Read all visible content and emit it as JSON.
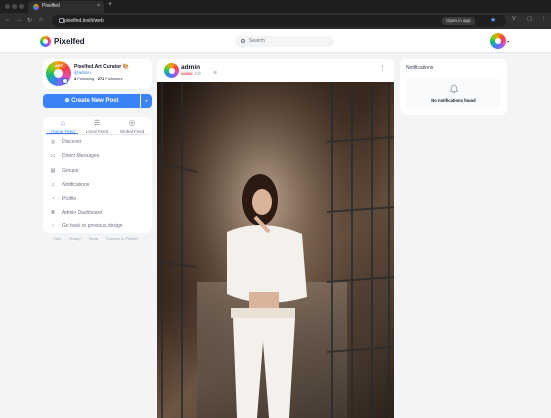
{
  "browser": {
    "tab_title": "Pixelfed",
    "tab_close": "×",
    "new_tab": "+",
    "url": "pixelfed.test/i/web",
    "open_in_app": "Open in app"
  },
  "header": {
    "brand": "Pixelfed",
    "search_placeholder": "Search",
    "avatar_caret": "▾"
  },
  "profile": {
    "name": "Pixelfed.Art Curator 🎨",
    "handle": "@admin",
    "following_count": "4",
    "following_label": "Following",
    "followers_count": "271",
    "followers_label": "Followers",
    "avatar_badge": "ART"
  },
  "compose": {
    "label": "Create New Post",
    "icon": "⊕",
    "caret": "▾"
  },
  "feed_tabs": [
    {
      "label": "Home Feed",
      "icon": "⌂",
      "active": true
    },
    {
      "label": "Local Feed",
      "icon": "☰",
      "active": false
    },
    {
      "label": "Global Feed",
      "icon": "◎",
      "active": false
    }
  ],
  "menu": [
    {
      "label": "Discover",
      "icon": "◎"
    },
    {
      "label": "Direct Messages",
      "icon": "▭"
    },
    {
      "label": "Groups",
      "icon": "▤"
    },
    {
      "label": "Notifications",
      "icon": "♫"
    },
    {
      "label": "Profile",
      "icon": "◔"
    },
    {
      "label": "Admin Dashboard",
      "icon": "⌘"
    },
    {
      "label": "Go back to previous design",
      "icon": "‹"
    }
  ],
  "footer_links": [
    "Help",
    "Privacy",
    "Terms",
    "Powered by Pixelfed"
  ],
  "post": {
    "username": "admin",
    "role_badge": "ADMIN",
    "time": "22h",
    "globe": "⊕",
    "more": "⋮"
  },
  "notifications": {
    "title": "Notifications",
    "empty_text": "No notifications found"
  },
  "colors": {
    "accent": "#3b82f6",
    "admin_badge": "#ef4444"
  }
}
